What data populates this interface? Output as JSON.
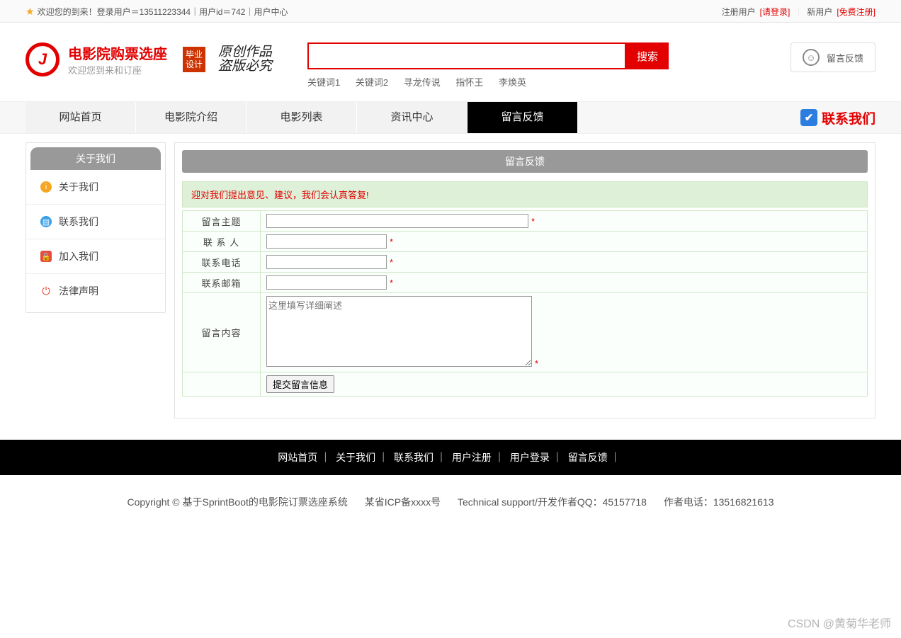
{
  "topbar": {
    "welcome": "欢迎您的到来！登录用户＝13511223344｜用户id＝742｜用户中心",
    "reg_user": "注册用户",
    "login_link": "[请登录]",
    "new_user": "新用户",
    "free_reg": "[免费注册]"
  },
  "logo": {
    "title": "电影院购票选座",
    "subtitle": "欢迎您到来和订座",
    "badge_l1": "毕业",
    "badge_l2": "设计",
    "cal_l1": "原创作品",
    "cal_l2": "盗版必究"
  },
  "search": {
    "btn": "搜索",
    "kw_label1": "关键词1",
    "kw_label2": "关键词2",
    "kw1": "寻龙传说",
    "kw2": "指怀王",
    "kw3": "李焕英"
  },
  "pill": {
    "label": "留言反馈"
  },
  "nav": {
    "items": [
      "网站首页",
      "电影院介绍",
      "电影列表",
      "资讯中心",
      "留言反馈"
    ],
    "contact": "联系我们"
  },
  "sidebar": {
    "title": "关于我们",
    "items": [
      "关于我们",
      "联系我们",
      "加入我们",
      "法律声明"
    ]
  },
  "panel": {
    "title": "留言反馈",
    "tip": "迎对我们提出意见、建议，我们会认真答复!",
    "labels": {
      "subject": "留言主题",
      "contact": "联 系 人",
      "phone": "联系电话",
      "email": "联系邮箱",
      "content": "留言内容"
    },
    "placeholder": "这里填写详细阐述",
    "submit": "提交留言信息",
    "star": "*"
  },
  "footer": {
    "links": [
      "网站首页",
      "关于我们",
      "联系我们",
      "用户注册",
      "用户登录",
      "留言反馈"
    ],
    "sep": "｜",
    "copyright": "Copyright © 基于SprintBoot的电影院订票选座系统",
    "icp": "某省ICP备xxxx号",
    "support": "Technical support/开发作者QQ：45157718",
    "author_phone": "作者电话：13516821613"
  },
  "watermark": "CSDN @黄菊华老师"
}
